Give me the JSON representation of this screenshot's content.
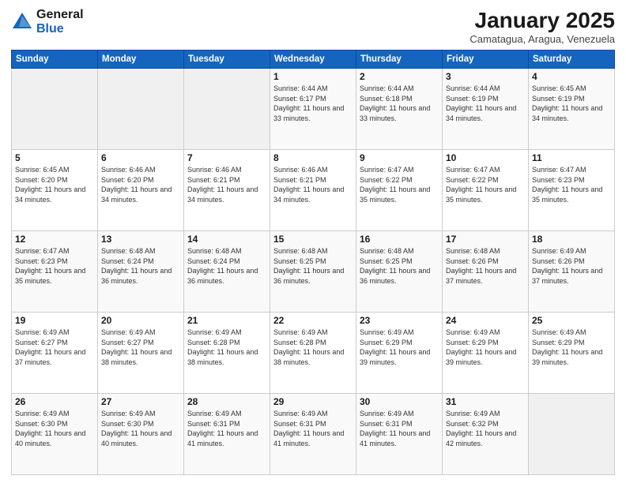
{
  "logo": {
    "general": "General",
    "blue": "Blue"
  },
  "title": "January 2025",
  "location": "Camatagua, Aragua, Venezuela",
  "weekdays": [
    "Sunday",
    "Monday",
    "Tuesday",
    "Wednesday",
    "Thursday",
    "Friday",
    "Saturday"
  ],
  "weeks": [
    [
      {
        "day": "",
        "sunrise": "",
        "sunset": "",
        "daylight": ""
      },
      {
        "day": "",
        "sunrise": "",
        "sunset": "",
        "daylight": ""
      },
      {
        "day": "",
        "sunrise": "",
        "sunset": "",
        "daylight": ""
      },
      {
        "day": "1",
        "sunrise": "Sunrise: 6:44 AM",
        "sunset": "Sunset: 6:17 PM",
        "daylight": "Daylight: 11 hours and 33 minutes."
      },
      {
        "day": "2",
        "sunrise": "Sunrise: 6:44 AM",
        "sunset": "Sunset: 6:18 PM",
        "daylight": "Daylight: 11 hours and 33 minutes."
      },
      {
        "day": "3",
        "sunrise": "Sunrise: 6:44 AM",
        "sunset": "Sunset: 6:19 PM",
        "daylight": "Daylight: 11 hours and 34 minutes."
      },
      {
        "day": "4",
        "sunrise": "Sunrise: 6:45 AM",
        "sunset": "Sunset: 6:19 PM",
        "daylight": "Daylight: 11 hours and 34 minutes."
      }
    ],
    [
      {
        "day": "5",
        "sunrise": "Sunrise: 6:45 AM",
        "sunset": "Sunset: 6:20 PM",
        "daylight": "Daylight: 11 hours and 34 minutes."
      },
      {
        "day": "6",
        "sunrise": "Sunrise: 6:46 AM",
        "sunset": "Sunset: 6:20 PM",
        "daylight": "Daylight: 11 hours and 34 minutes."
      },
      {
        "day": "7",
        "sunrise": "Sunrise: 6:46 AM",
        "sunset": "Sunset: 6:21 PM",
        "daylight": "Daylight: 11 hours and 34 minutes."
      },
      {
        "day": "8",
        "sunrise": "Sunrise: 6:46 AM",
        "sunset": "Sunset: 6:21 PM",
        "daylight": "Daylight: 11 hours and 34 minutes."
      },
      {
        "day": "9",
        "sunrise": "Sunrise: 6:47 AM",
        "sunset": "Sunset: 6:22 PM",
        "daylight": "Daylight: 11 hours and 35 minutes."
      },
      {
        "day": "10",
        "sunrise": "Sunrise: 6:47 AM",
        "sunset": "Sunset: 6:22 PM",
        "daylight": "Daylight: 11 hours and 35 minutes."
      },
      {
        "day": "11",
        "sunrise": "Sunrise: 6:47 AM",
        "sunset": "Sunset: 6:23 PM",
        "daylight": "Daylight: 11 hours and 35 minutes."
      }
    ],
    [
      {
        "day": "12",
        "sunrise": "Sunrise: 6:47 AM",
        "sunset": "Sunset: 6:23 PM",
        "daylight": "Daylight: 11 hours and 35 minutes."
      },
      {
        "day": "13",
        "sunrise": "Sunrise: 6:48 AM",
        "sunset": "Sunset: 6:24 PM",
        "daylight": "Daylight: 11 hours and 36 minutes."
      },
      {
        "day": "14",
        "sunrise": "Sunrise: 6:48 AM",
        "sunset": "Sunset: 6:24 PM",
        "daylight": "Daylight: 11 hours and 36 minutes."
      },
      {
        "day": "15",
        "sunrise": "Sunrise: 6:48 AM",
        "sunset": "Sunset: 6:25 PM",
        "daylight": "Daylight: 11 hours and 36 minutes."
      },
      {
        "day": "16",
        "sunrise": "Sunrise: 6:48 AM",
        "sunset": "Sunset: 6:25 PM",
        "daylight": "Daylight: 11 hours and 36 minutes."
      },
      {
        "day": "17",
        "sunrise": "Sunrise: 6:48 AM",
        "sunset": "Sunset: 6:26 PM",
        "daylight": "Daylight: 11 hours and 37 minutes."
      },
      {
        "day": "18",
        "sunrise": "Sunrise: 6:49 AM",
        "sunset": "Sunset: 6:26 PM",
        "daylight": "Daylight: 11 hours and 37 minutes."
      }
    ],
    [
      {
        "day": "19",
        "sunrise": "Sunrise: 6:49 AM",
        "sunset": "Sunset: 6:27 PM",
        "daylight": "Daylight: 11 hours and 37 minutes."
      },
      {
        "day": "20",
        "sunrise": "Sunrise: 6:49 AM",
        "sunset": "Sunset: 6:27 PM",
        "daylight": "Daylight: 11 hours and 38 minutes."
      },
      {
        "day": "21",
        "sunrise": "Sunrise: 6:49 AM",
        "sunset": "Sunset: 6:28 PM",
        "daylight": "Daylight: 11 hours and 38 minutes."
      },
      {
        "day": "22",
        "sunrise": "Sunrise: 6:49 AM",
        "sunset": "Sunset: 6:28 PM",
        "daylight": "Daylight: 11 hours and 38 minutes."
      },
      {
        "day": "23",
        "sunrise": "Sunrise: 6:49 AM",
        "sunset": "Sunset: 6:29 PM",
        "daylight": "Daylight: 11 hours and 39 minutes."
      },
      {
        "day": "24",
        "sunrise": "Sunrise: 6:49 AM",
        "sunset": "Sunset: 6:29 PM",
        "daylight": "Daylight: 11 hours and 39 minutes."
      },
      {
        "day": "25",
        "sunrise": "Sunrise: 6:49 AM",
        "sunset": "Sunset: 6:29 PM",
        "daylight": "Daylight: 11 hours and 39 minutes."
      }
    ],
    [
      {
        "day": "26",
        "sunrise": "Sunrise: 6:49 AM",
        "sunset": "Sunset: 6:30 PM",
        "daylight": "Daylight: 11 hours and 40 minutes."
      },
      {
        "day": "27",
        "sunrise": "Sunrise: 6:49 AM",
        "sunset": "Sunset: 6:30 PM",
        "daylight": "Daylight: 11 hours and 40 minutes."
      },
      {
        "day": "28",
        "sunrise": "Sunrise: 6:49 AM",
        "sunset": "Sunset: 6:31 PM",
        "daylight": "Daylight: 11 hours and 41 minutes."
      },
      {
        "day": "29",
        "sunrise": "Sunrise: 6:49 AM",
        "sunset": "Sunset: 6:31 PM",
        "daylight": "Daylight: 11 hours and 41 minutes."
      },
      {
        "day": "30",
        "sunrise": "Sunrise: 6:49 AM",
        "sunset": "Sunset: 6:31 PM",
        "daylight": "Daylight: 11 hours and 41 minutes."
      },
      {
        "day": "31",
        "sunrise": "Sunrise: 6:49 AM",
        "sunset": "Sunset: 6:32 PM",
        "daylight": "Daylight: 11 hours and 42 minutes."
      },
      {
        "day": "",
        "sunrise": "",
        "sunset": "",
        "daylight": ""
      }
    ]
  ]
}
